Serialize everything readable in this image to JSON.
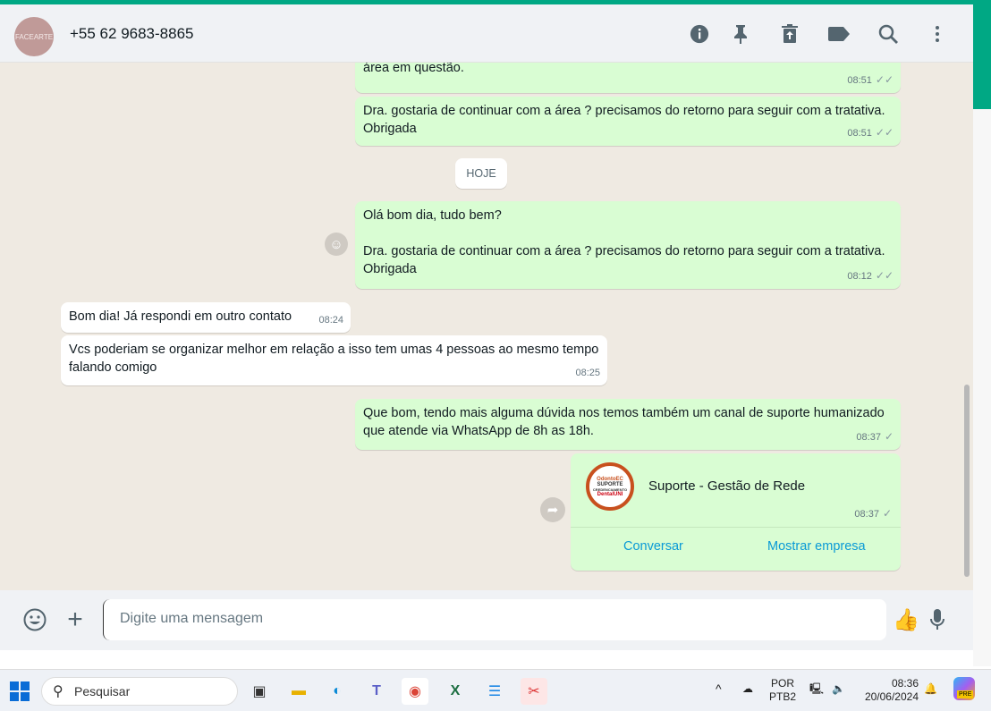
{
  "header": {
    "avatar_text": "FACEARTE",
    "contact": "+55 62 9683-8865",
    "icons": [
      "info-icon",
      "pin-icon",
      "delete-icon",
      "label-icon",
      "search-icon",
      "menu-icon"
    ]
  },
  "messages": [
    {
      "dir": "out",
      "text": "área em questão.",
      "time": "08:51",
      "status": "read"
    },
    {
      "dir": "out",
      "text": "Dra. gostaria de continuar com a área ? precisamos do retorno para seguir com a tratativa. Obrigada",
      "time": "08:51",
      "status": "read"
    },
    {
      "dir": "out",
      "text": "Olá bom dia, tudo bem?\n\nDra. gostaria de continuar com a área ? precisamos do retorno para seguir com a tratativa. Obrigada",
      "time": "08:12",
      "status": "read"
    },
    {
      "dir": "in",
      "text": "Bom dia! Já respondi em outro contato",
      "time": "08:24"
    },
    {
      "dir": "in",
      "text": "Vcs poderiam se organizar melhor em relação a isso tem umas 4 pessoas ao mesmo tempo falando comigo",
      "time": "08:25"
    },
    {
      "dir": "out",
      "text": "Que bom, tendo mais alguma dúvida nos temos também um canal de suporte humanizado que atende via WhatsApp de 8h as 18h.",
      "time": "08:37",
      "status": "sent"
    }
  ],
  "date_divider": "HOJE",
  "contact_card": {
    "logo_lines": [
      "OdontoEC",
      "SUPORTE",
      "CREDENCIAMENTO",
      "DentalUNI"
    ],
    "name": "Suporte - Gestão de Rede",
    "time": "08:37",
    "status": "sent",
    "buttons": [
      "Conversar",
      "Mostrar empresa"
    ]
  },
  "composer": {
    "placeholder": "Digite uma mensagem"
  },
  "taskbar": {
    "search": "Pesquisar",
    "lang1": "POR",
    "lang2": "PTB2",
    "time": "08:36",
    "date": "20/06/2024",
    "copilot_badge": "PRE"
  },
  "colors": {
    "accent": "#00a884",
    "outgoing": "#d9fdd3",
    "link": "#0a9ad6"
  }
}
